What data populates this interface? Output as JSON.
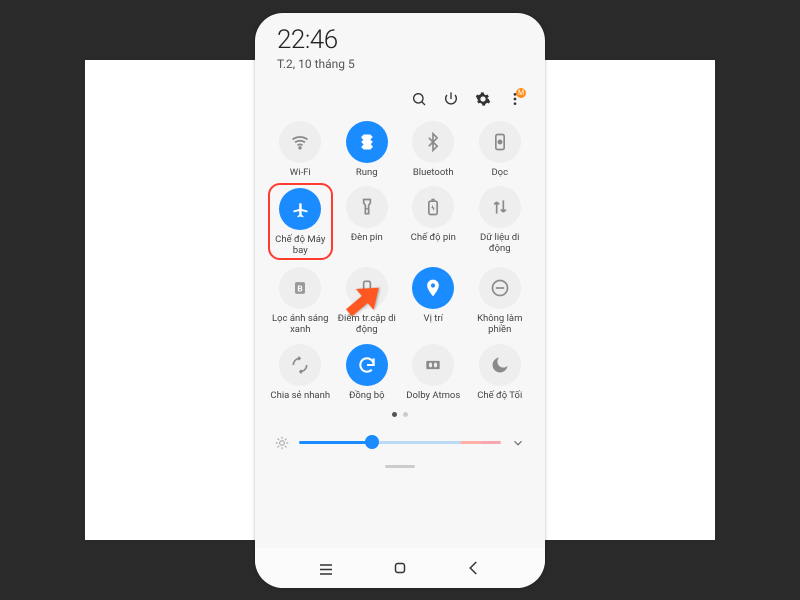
{
  "status": {
    "time": "22:46",
    "date": "T.2, 10 tháng 5"
  },
  "topicons": {
    "search": "search-icon",
    "power": "power-icon",
    "settings": "gear-icon",
    "more": "more-icon",
    "more_badge": "M"
  },
  "tiles": [
    {
      "id": "wifi",
      "label": "Wi-Fi",
      "icon": "wifi-icon",
      "active": false
    },
    {
      "id": "rung",
      "label": "Rung",
      "icon": "vibrate-icon",
      "active": true
    },
    {
      "id": "bluetooth",
      "label": "Bluetooth",
      "icon": "bluetooth-icon",
      "active": false
    },
    {
      "id": "doc",
      "label": "Dọc",
      "icon": "portrait-lock-icon",
      "active": false
    },
    {
      "id": "airplane",
      "label": "Chế độ Máy bay",
      "icon": "airplane-icon",
      "active": true,
      "highlighted": true
    },
    {
      "id": "flashlight",
      "label": "Đèn pin",
      "icon": "flashlight-icon",
      "active": false
    },
    {
      "id": "battery",
      "label": "Chế độ pin",
      "icon": "battery-icon",
      "active": false
    },
    {
      "id": "data",
      "label": "Dữ liệu di động",
      "icon": "mobile-data-icon",
      "active": false
    },
    {
      "id": "bluelight",
      "label": "Lọc ánh sáng xanh",
      "icon": "bluelight-icon",
      "active": false
    },
    {
      "id": "hotspot",
      "label": "Điểm tr.cập di động",
      "icon": "hotspot-icon",
      "active": false
    },
    {
      "id": "location",
      "label": "Vị trí",
      "icon": "location-icon",
      "active": true
    },
    {
      "id": "dnd",
      "label": "Không làm phiền",
      "icon": "dnd-icon",
      "active": false
    },
    {
      "id": "nearby",
      "label": "Chia sẻ nhanh",
      "icon": "nearby-share-icon",
      "active": false
    },
    {
      "id": "sync",
      "label": "Đồng bộ",
      "icon": "sync-icon",
      "active": true
    },
    {
      "id": "dolby",
      "label": "Dolby Atmos",
      "icon": "dolby-icon",
      "active": false
    },
    {
      "id": "dark",
      "label": "Chế độ Tối",
      "icon": "dark-mode-icon",
      "active": false
    }
  ],
  "pager": {
    "pages": 2,
    "current": 0
  },
  "brightness": {
    "percent": 36
  },
  "nav": {
    "recents": "recents-button",
    "home": "home-button",
    "back": "back-button"
  },
  "colors": {
    "accent": "#1a8cff",
    "tile_off_bg": "#eeeeee",
    "tile_off_fg": "#8a8a8a",
    "highlight": "#ff3b30"
  }
}
